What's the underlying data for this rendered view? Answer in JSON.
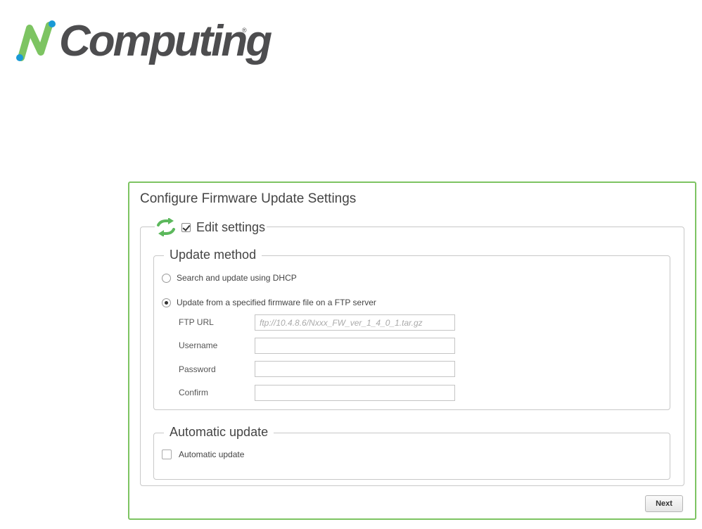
{
  "brand": {
    "logo_text": "Computing",
    "logo_letter": "N",
    "registered_mark": "®",
    "accent_color": "#7dc462",
    "logo_blue": "#1a9ad6"
  },
  "panel": {
    "title": "Configure Firmware Update Settings",
    "edit_settings": {
      "icon": "refresh-icon",
      "label": "Edit settings",
      "checked": true
    },
    "update_method": {
      "legend": "Update method",
      "options": [
        {
          "label": "Search and update using DHCP",
          "selected": false
        },
        {
          "label": "Update from a specified firmware file on a FTP server",
          "selected": true
        }
      ],
      "fields": {
        "ftp_url": {
          "label": "FTP URL",
          "value": "",
          "placeholder": "ftp://10.4.8.6/Nxxx_FW_ver_1_4_0_1.tar.gz"
        },
        "username": {
          "label": "Username",
          "value": ""
        },
        "password": {
          "label": "Password",
          "value": ""
        },
        "confirm": {
          "label": "Confirm",
          "value": ""
        }
      }
    },
    "automatic_update": {
      "legend": "Automatic update",
      "checkbox_label": "Automatic update",
      "checked": false
    },
    "next_label": "Next"
  }
}
